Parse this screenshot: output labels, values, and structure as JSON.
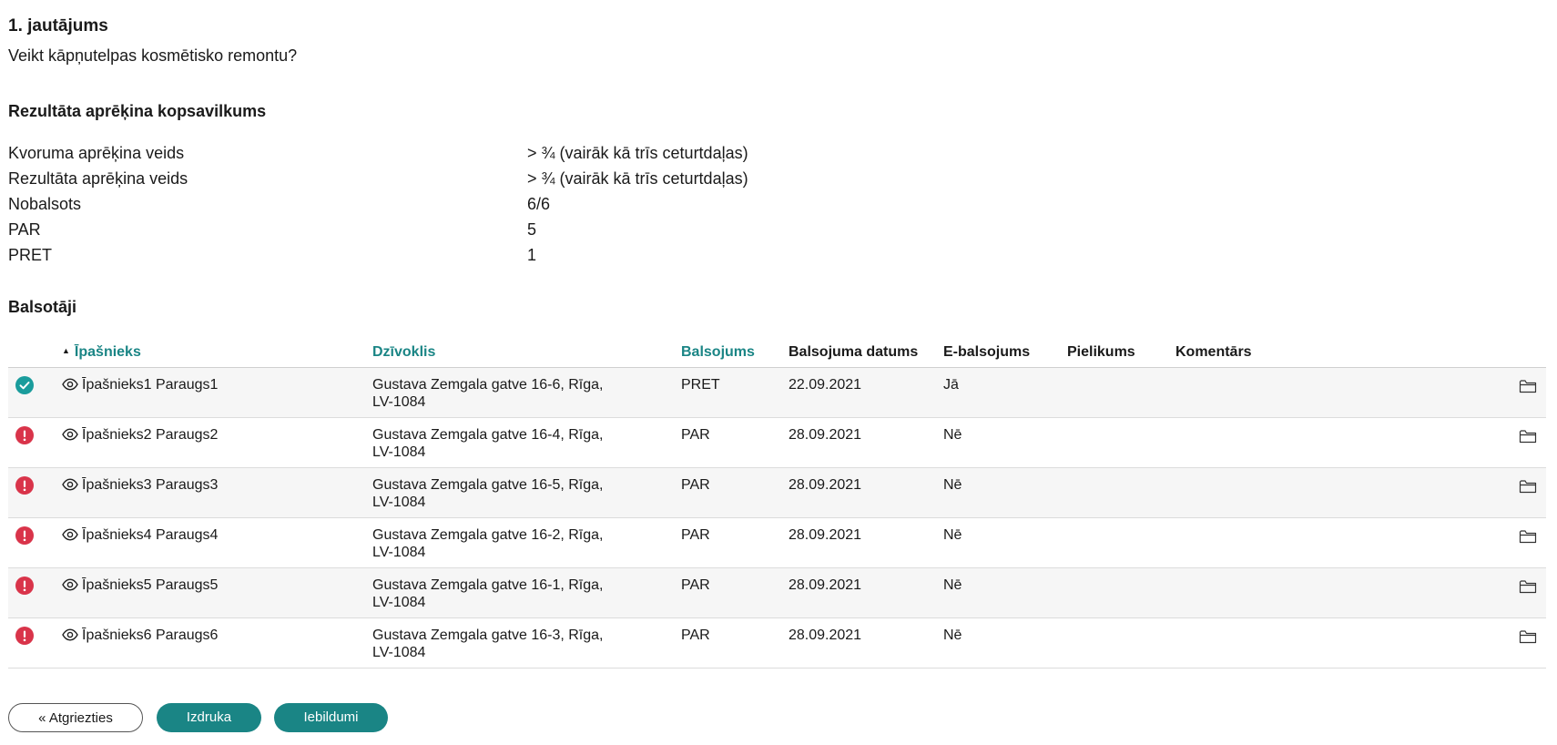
{
  "question": {
    "title": "1. jautājums",
    "text": "Veikt kāpņutelpas kosmētisko remontu?"
  },
  "summary": {
    "title": "Rezultāta aprēķina kopsavilkums",
    "rows": [
      {
        "label": "Kvoruma aprēķina veids",
        "value": "> ¾ (vairāk kā trīs ceturtdaļas)"
      },
      {
        "label": "Rezultāta aprēķina veids",
        "value": "> ¾ (vairāk kā trīs ceturtdaļas)"
      },
      {
        "label": "Nobalsots",
        "value": "6/6"
      },
      {
        "label": "PAR",
        "value": "5"
      },
      {
        "label": "PRET",
        "value": "1"
      }
    ]
  },
  "voters": {
    "title": "Balsotāji",
    "columns": {
      "owner": "Īpašnieks",
      "flat": "Dzīvoklis",
      "vote": "Balsojums",
      "date": "Balsojuma datums",
      "evote": "E-balsojums",
      "attachment": "Pielikums",
      "comment": "Komentārs"
    },
    "rows": [
      {
        "status": "ok",
        "owner": "Īpašnieks1 Paraugs1",
        "flat": "Gustava Zemgala gatve 16-6, Rīga, LV-1084",
        "vote": "PRET",
        "date": "22.09.2021",
        "evote": "Jā"
      },
      {
        "status": "warn",
        "owner": "Īpašnieks2 Paraugs2",
        "flat": "Gustava Zemgala gatve 16-4, Rīga, LV-1084",
        "vote": "PAR",
        "date": "28.09.2021",
        "evote": "Nē"
      },
      {
        "status": "warn",
        "owner": "Īpašnieks3 Paraugs3",
        "flat": "Gustava Zemgala gatve 16-5, Rīga, LV-1084",
        "vote": "PAR",
        "date": "28.09.2021",
        "evote": "Nē"
      },
      {
        "status": "warn",
        "owner": "Īpašnieks4 Paraugs4",
        "flat": "Gustava Zemgala gatve 16-2, Rīga, LV-1084",
        "vote": "PAR",
        "date": "28.09.2021",
        "evote": "Nē"
      },
      {
        "status": "warn",
        "owner": "Īpašnieks5 Paraugs5",
        "flat": "Gustava Zemgala gatve 16-1, Rīga, LV-1084",
        "vote": "PAR",
        "date": "28.09.2021",
        "evote": "Nē"
      },
      {
        "status": "warn",
        "owner": "Īpašnieks6 Paraugs6",
        "flat": "Gustava Zemgala gatve 16-3, Rīga, LV-1084",
        "vote": "PAR",
        "date": "28.09.2021",
        "evote": "Nē"
      }
    ]
  },
  "buttons": {
    "back": "« Atgriezties",
    "print": "Izdruka",
    "objections": "Iebildumi"
  },
  "colors": {
    "accent": "#1a8585",
    "ok": "#1a9c9c",
    "warn": "#d9344a"
  },
  "icons": {
    "status_ok": "check-circle-icon",
    "status_warn": "exclamation-circle-icon",
    "owner": "eye-icon",
    "row_action": "folder-icon",
    "sort": "sort-ascending-icon"
  }
}
